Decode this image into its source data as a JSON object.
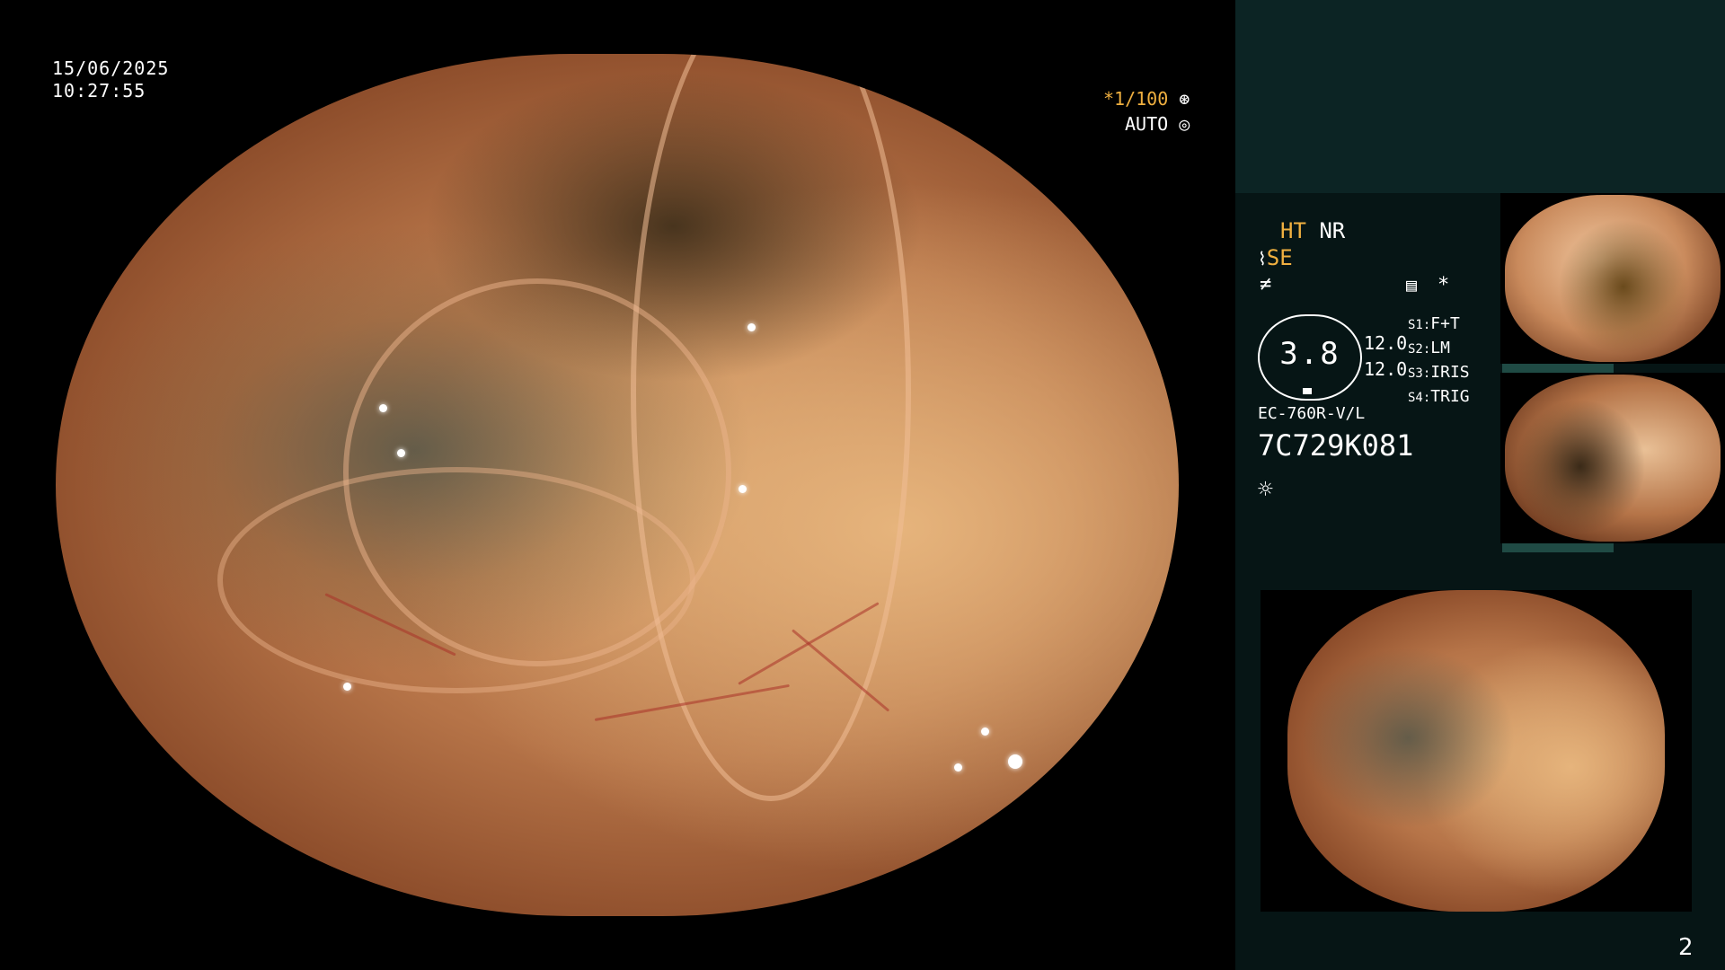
{
  "datetime": {
    "date": "15/06/2025",
    "time": "10:27:55"
  },
  "exposure": {
    "shutter": "*1/100",
    "mode": "AUTO"
  },
  "status_flags": {
    "ht": "HT",
    "nr": "NR",
    "se": "SE"
  },
  "gauge": {
    "value": "3.8",
    "readout_1": "12.0",
    "readout_2": "12.0"
  },
  "switches": [
    {
      "key": "S1:",
      "value": "F+T"
    },
    {
      "key": "S2:",
      "value": "LM"
    },
    {
      "key": "S3:",
      "value": "IRIS"
    },
    {
      "key": "S4:",
      "value": "TRIG"
    }
  ],
  "scope": {
    "model": "EC-760R-V/L",
    "serial": "7C729K081"
  },
  "page_number": "2",
  "colors": {
    "accent_orange": "#f0b040",
    "panel_dark": "#061515",
    "panel_top": "#0c2424"
  },
  "icons": [
    "shutter-icon",
    "auto-iris-icon",
    "scope-icon",
    "freeze-icon",
    "memo-icon",
    "star-icon",
    "light-icon"
  ]
}
